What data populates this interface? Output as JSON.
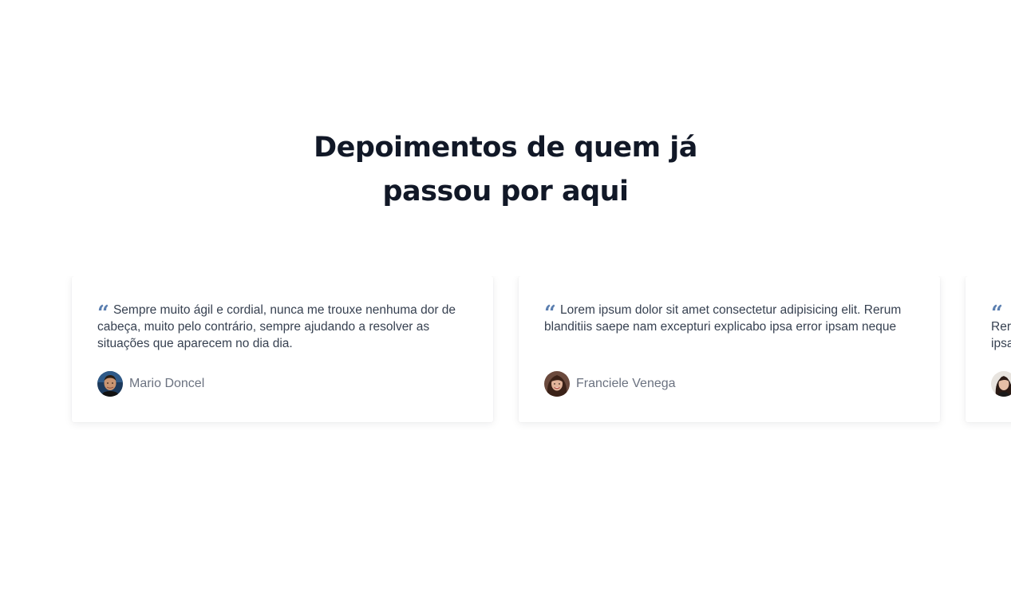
{
  "section": {
    "title_line1": "Depoimentos de quem já",
    "title_line2": "passou por aqui"
  },
  "testimonials": [
    {
      "quote_icon": "“",
      "text": "Sempre muito ágil e cordial, nunca me trouxe nenhuma dor de cabeça, muito pelo contrário, sempre ajudando a resolver as situações que aparecem no dia dia.",
      "author": "Mario Doncel",
      "avatar_icon": "avatar-man-photo"
    },
    {
      "quote_icon": "“",
      "text": "Lorem ipsum dolor sit amet consectetur adipisicing elit. Rerum blanditiis saepe nam excepturi explicabo ipsa error ipsam neque",
      "author": "Franciele Venega",
      "avatar_icon": "avatar-woman-photo"
    },
    {
      "quote_icon": "“",
      "text": "Rer",
      "text_line2": "ipsa",
      "author": "",
      "avatar_icon": "avatar-woman-photo"
    }
  ],
  "colors": {
    "title": "#111827",
    "quote_icon": "#5b7fb0",
    "body_text": "#374151",
    "author_text": "#6b7280"
  }
}
